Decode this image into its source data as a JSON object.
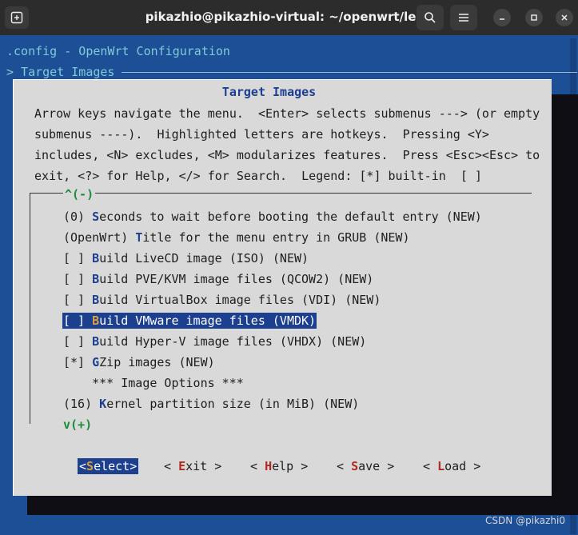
{
  "window": {
    "title": "pikazhio@pikazhio-virtual: ~/openwrt/lede"
  },
  "terminal": {
    "header_config": ".config - OpenWrt Configuration",
    "header_path": "> Target Images"
  },
  "dialog": {
    "title": "Target Images",
    "help_lines": [
      "Arrow keys navigate the menu.  <Enter> selects submenus ---> (or empty",
      "submenus ----).  Highlighted letters are hotkeys.  Pressing <Y>",
      "includes, <N> excludes, <M> modularizes features.  Press <Esc><Esc> to",
      "exit, <?> for Help, </> for Search.  Legend: [*] built-in  [ ]"
    ],
    "scroll_up": "^(-)",
    "scroll_down": "v(+)",
    "items": [
      {
        "prefix": "(0) ",
        "hot": "S",
        "rest": "econds to wait before booting the default entry (NEW)"
      },
      {
        "prefix": "(OpenWrt) ",
        "hot": "T",
        "rest": "itle for the menu entry in GRUB (NEW)"
      },
      {
        "prefix": "[ ] ",
        "hot": "B",
        "rest": "uild LiveCD image (ISO) (NEW)"
      },
      {
        "prefix": "[ ] ",
        "hot": "B",
        "rest": "uild PVE/KVM image files (QCOW2) (NEW)"
      },
      {
        "prefix": "[ ] ",
        "hot": "B",
        "rest": "uild VirtualBox image files (VDI) (NEW)"
      },
      {
        "prefix": "[ ] ",
        "hot": "B",
        "rest": "uild VMware image files (VMDK)"
      },
      {
        "prefix": "[ ] ",
        "hot": "B",
        "rest": "uild Hyper-V image files (VHDX) (NEW)"
      },
      {
        "prefix": "[*] ",
        "hot": "G",
        "rest": "Zip images (NEW)"
      },
      {
        "prefix": "    ",
        "hot": "",
        "rest": "*** Image Options ***"
      },
      {
        "prefix": "(16) ",
        "hot": "K",
        "rest": "ernel partition size (in MiB) (NEW)"
      }
    ],
    "selected_index": 5
  },
  "buttons": [
    {
      "left": "<",
      "hot": "S",
      "rest": "elect",
      "right": ">"
    },
    {
      "left": "< ",
      "hot": "E",
      "rest": "xit",
      "right": " >"
    },
    {
      "left": "< ",
      "hot": "H",
      "rest": "elp",
      "right": " >"
    },
    {
      "left": "< ",
      "hot": "S",
      "rest": "ave",
      "right": " >"
    },
    {
      "left": "< ",
      "hot": "L",
      "rest": "oad",
      "right": " >"
    }
  ],
  "watermark": "CSDN @pikazhi0",
  "icons": {
    "new_tab": "new-tab-icon",
    "search": "search-icon",
    "menu": "hamburger-menu-icon",
    "minimize": "minimize-icon",
    "maximize": "maximize-icon",
    "close": "close-icon"
  }
}
